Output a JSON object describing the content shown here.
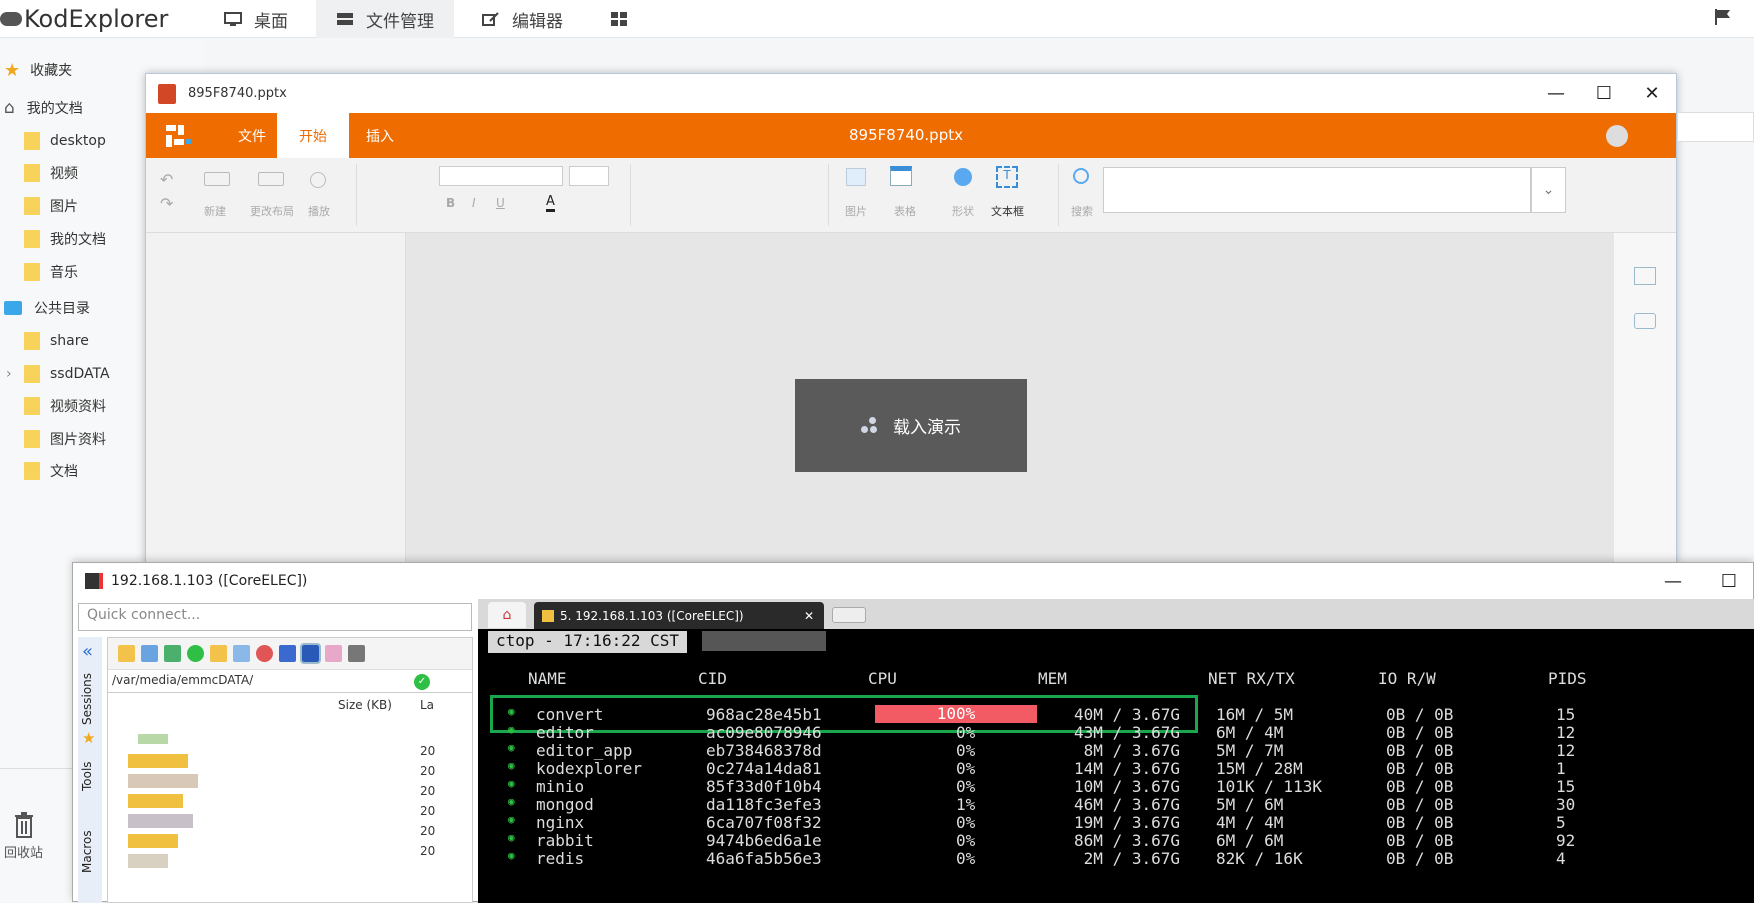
{
  "app": {
    "brand": "KodExplorer"
  },
  "nav": [
    {
      "label": "桌面",
      "icon": "monitor-icon"
    },
    {
      "label": "文件管理",
      "icon": "drive-icon"
    },
    {
      "label": "编辑器",
      "icon": "edit-icon"
    },
    {
      "label": "",
      "icon": "grid-icon"
    }
  ],
  "sidebar": {
    "favorites": "收藏夹",
    "mydocs": "我的文档",
    "mydocs_items": [
      "desktop",
      "视频",
      "图片",
      "我的文档",
      "音乐"
    ],
    "public": "公共目录",
    "public_items": [
      "share",
      "ssdDATA",
      "视频资料",
      "图片资料",
      "文档"
    ],
    "trash": "回收站"
  },
  "ppt": {
    "window_title": "895F8740.pptx",
    "doc_title": "895F8740.pptx",
    "tabs": [
      "文件",
      "开始",
      "插入"
    ],
    "active_tab": "开始",
    "toolbar_labels": {
      "new": "新建",
      "layout": "更改布局",
      "play": "播放",
      "image": "图片",
      "table": "表格",
      "shape": "形状",
      "textbox": "文本框",
      "search": "搜索"
    },
    "loading": "载入演示"
  },
  "ssh": {
    "window_title": "192.168.1.103 ([CoreELEC])",
    "quick_connect_placeholder": "Quick connect...",
    "side_tabs": [
      "Sessions",
      "Tools",
      "Macros"
    ],
    "path": "/var/media/emmcDATA/",
    "file_cols": [
      "Size (KB)",
      "La"
    ],
    "file_sizes": [
      "20",
      "20",
      "20",
      "20",
      "20",
      "20"
    ],
    "tab_label": "5. 192.168.1.103 ([CoreELEC])"
  },
  "ctop": {
    "header": "ctop - 17:16:22 CST",
    "columns": [
      "NAME",
      "CID",
      "CPU",
      "MEM",
      "NET RX/TX",
      "IO R/W",
      "PIDS"
    ],
    "rows": [
      {
        "name": "convert",
        "cid": "968ac28e45b1",
        "cpu": "100%",
        "mem": "40M / 3.67G",
        "net": "16M / 5M",
        "io": "0B / 0B",
        "pids": "15"
      },
      {
        "name": "editor",
        "cid": "ac09e8078946",
        "cpu": "0%",
        "mem": "43M / 3.67G",
        "net": "6M / 4M",
        "io": "0B / 0B",
        "pids": "12"
      },
      {
        "name": "editor_app",
        "cid": "eb738468378d",
        "cpu": "0%",
        "mem": "8M / 3.67G",
        "net": "5M / 7M",
        "io": "0B / 0B",
        "pids": "12"
      },
      {
        "name": "kodexplorer",
        "cid": "0c274a14da81",
        "cpu": "0%",
        "mem": "14M / 3.67G",
        "net": "15M / 28M",
        "io": "0B / 0B",
        "pids": "1"
      },
      {
        "name": "minio",
        "cid": "85f33d0f10b4",
        "cpu": "0%",
        "mem": "10M / 3.67G",
        "net": "101K / 113K",
        "io": "0B / 0B",
        "pids": "15"
      },
      {
        "name": "mongod",
        "cid": "da118fc3efe3",
        "cpu": "1%",
        "mem": "46M / 3.67G",
        "net": "5M / 6M",
        "io": "0B / 0B",
        "pids": "30"
      },
      {
        "name": "nginx",
        "cid": "6ca707f08f32",
        "cpu": "0%",
        "mem": "19M / 3.67G",
        "net": "4M / 4M",
        "io": "0B / 0B",
        "pids": "5"
      },
      {
        "name": "rabbit",
        "cid": "9474b6ed6a1e",
        "cpu": "0%",
        "mem": "86M / 3.67G",
        "net": "6M / 6M",
        "io": "0B / 0B",
        "pids": "92"
      },
      {
        "name": "redis",
        "cid": "46a6fa5b56e3",
        "cpu": "0%",
        "mem": "2M / 3.67G",
        "net": "82K / 16K",
        "io": "0B / 0B",
        "pids": "4"
      }
    ]
  },
  "colors": {
    "accent": "#ef6c00",
    "highlight": "#1aa64a",
    "cpu_bar": "#f25b64"
  }
}
